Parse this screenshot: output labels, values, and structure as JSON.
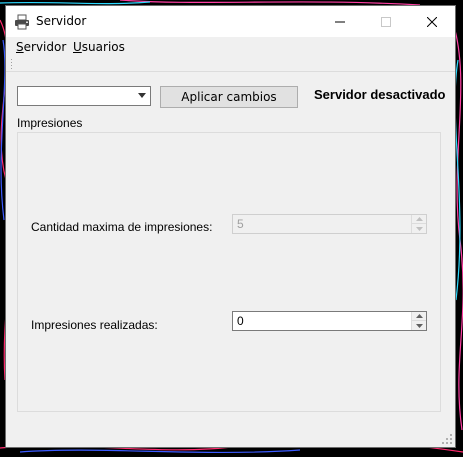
{
  "window": {
    "title": "Servidor"
  },
  "menu": {
    "items": [
      {
        "label": "Servidor",
        "mnemonic": "S",
        "rest": "ervidor"
      },
      {
        "label": "Usuarios",
        "mnemonic": "U",
        "rest": "suarios"
      }
    ]
  },
  "toolbar": {
    "combo_value": "",
    "apply_label": "Aplicar cambios",
    "status_text": "Servidor desactivado"
  },
  "group": {
    "title": "Impresiones",
    "fields": [
      {
        "label": "Cantidad maxima de impresiones:",
        "value": "5",
        "enabled": false
      },
      {
        "label": "Impresiones realizadas:",
        "value": "0",
        "enabled": true
      }
    ]
  },
  "icons": {
    "app": "printer-icon",
    "minimize": "minimize-icon",
    "maximize": "maximize-icon",
    "close": "close-icon"
  },
  "colors": {
    "window_bg": "#f0f0f0",
    "titlebar_bg": "#ffffff",
    "desktop_bg": "#000000"
  }
}
